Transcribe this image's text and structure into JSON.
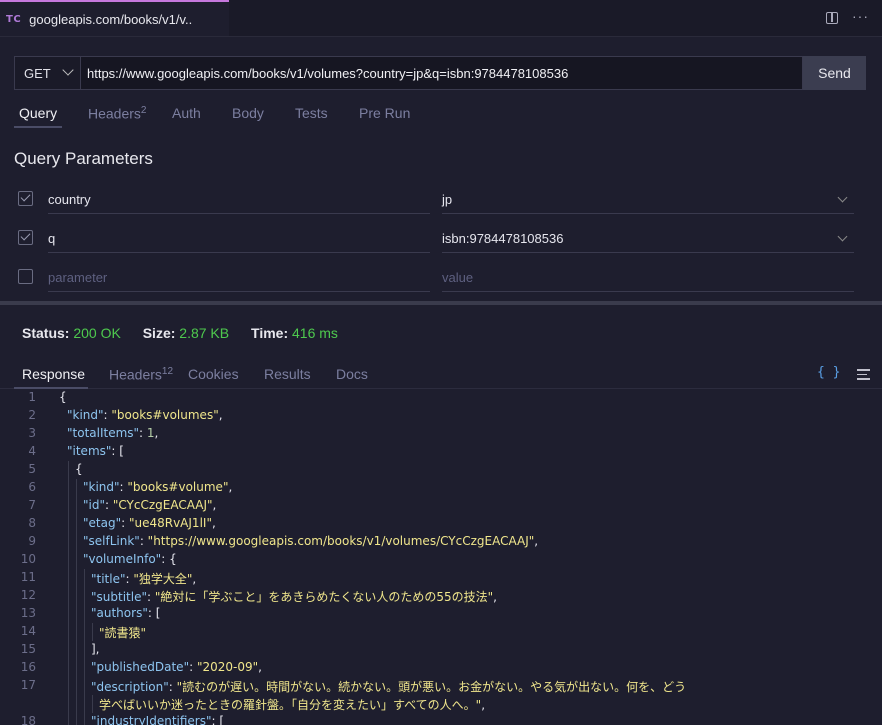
{
  "tab": {
    "logo": "TC",
    "title": "googleapis.com/books/v1/v.."
  },
  "toolbar": {
    "split_icon": "split-view-icon",
    "more_icon": "more-icon"
  },
  "request": {
    "method": "GET",
    "url": "https://www.googleapis.com/books/v1/volumes?country=jp&q=isbn:9784478108536",
    "send_label": "Send"
  },
  "request_tabs": [
    {
      "label": "Query",
      "badge": ""
    },
    {
      "label": "Headers",
      "badge": "2"
    },
    {
      "label": "Auth",
      "badge": ""
    },
    {
      "label": "Body",
      "badge": ""
    },
    {
      "label": "Tests",
      "badge": ""
    },
    {
      "label": "Pre Run",
      "badge": ""
    }
  ],
  "query_params": {
    "title": "Query Parameters",
    "rows": [
      {
        "key": "country",
        "value": "jp",
        "checked": true
      },
      {
        "key": "q",
        "value": "isbn:9784478108536",
        "checked": true
      }
    ],
    "new_row": {
      "key_placeholder": "parameter",
      "value_placeholder": "value"
    }
  },
  "status": {
    "status_label": "Status:",
    "status_value": "200 OK",
    "size_label": "Size:",
    "size_value": "2.87 KB",
    "time_label": "Time:",
    "time_value": "416 ms"
  },
  "response_tabs": [
    {
      "label": "Response",
      "badge": ""
    },
    {
      "label": "Headers",
      "badge": "12"
    },
    {
      "label": "Cookies",
      "badge": ""
    },
    {
      "label": "Results",
      "badge": ""
    },
    {
      "label": "Docs",
      "badge": ""
    }
  ],
  "response_icons": {
    "format": "{ }",
    "menu": "menu-icon"
  },
  "code_lines": [
    {
      "n": "1",
      "indent": 0,
      "parts": [
        [
          "p",
          "{"
        ]
      ]
    },
    {
      "n": "2",
      "indent": 1,
      "parts": [
        [
          "k",
          "\"kind\""
        ],
        [
          "p",
          ": "
        ],
        [
          "s",
          "\"books#volumes\""
        ],
        [
          "p",
          ","
        ]
      ]
    },
    {
      "n": "3",
      "indent": 1,
      "parts": [
        [
          "k",
          "\"totalItems\""
        ],
        [
          "p",
          ": "
        ],
        [
          "n",
          "1"
        ],
        [
          "p",
          ","
        ]
      ]
    },
    {
      "n": "4",
      "indent": 1,
      "parts": [
        [
          "k",
          "\"items\""
        ],
        [
          "p",
          ": ["
        ]
      ]
    },
    {
      "n": "5",
      "indent": 2,
      "parts": [
        [
          "p",
          "{"
        ]
      ]
    },
    {
      "n": "6",
      "indent": 3,
      "parts": [
        [
          "k",
          "\"kind\""
        ],
        [
          "p",
          ": "
        ],
        [
          "s",
          "\"books#volume\""
        ],
        [
          "p",
          ","
        ]
      ]
    },
    {
      "n": "7",
      "indent": 3,
      "parts": [
        [
          "k",
          "\"id\""
        ],
        [
          "p",
          ": "
        ],
        [
          "s",
          "\"CYcCzgEACAAJ\""
        ],
        [
          "p",
          ","
        ]
      ]
    },
    {
      "n": "8",
      "indent": 3,
      "parts": [
        [
          "k",
          "\"etag\""
        ],
        [
          "p",
          ": "
        ],
        [
          "s",
          "\"ue48RvAJ1lI\""
        ],
        [
          "p",
          ","
        ]
      ]
    },
    {
      "n": "9",
      "indent": 3,
      "parts": [
        [
          "k",
          "\"selfLink\""
        ],
        [
          "p",
          ": "
        ],
        [
          "s",
          "\"https://www.googleapis.com/books/v1/volumes/CYcCzgEACAAJ\""
        ],
        [
          "p",
          ","
        ]
      ]
    },
    {
      "n": "10",
      "indent": 3,
      "parts": [
        [
          "k",
          "\"volumeInfo\""
        ],
        [
          "p",
          ": {"
        ]
      ]
    },
    {
      "n": "11",
      "indent": 4,
      "parts": [
        [
          "k",
          "\"title\""
        ],
        [
          "p",
          ": "
        ],
        [
          "s",
          "\"独学大全\""
        ],
        [
          "p",
          ","
        ]
      ]
    },
    {
      "n": "12",
      "indent": 4,
      "parts": [
        [
          "k",
          "\"subtitle\""
        ],
        [
          "p",
          ": "
        ],
        [
          "s",
          "\"絶対に「学ぶこと」をあきらめたくない人のための55の技法\""
        ],
        [
          "p",
          ","
        ]
      ]
    },
    {
      "n": "13",
      "indent": 4,
      "parts": [
        [
          "k",
          "\"authors\""
        ],
        [
          "p",
          ": ["
        ]
      ]
    },
    {
      "n": "14",
      "indent": 5,
      "parts": [
        [
          "s",
          "\"読書猿\""
        ]
      ]
    },
    {
      "n": "15",
      "indent": 4,
      "parts": [
        [
          "p",
          "],"
        ]
      ]
    },
    {
      "n": "16",
      "indent": 4,
      "parts": [
        [
          "k",
          "\"publishedDate\""
        ],
        [
          "p",
          ": "
        ],
        [
          "s",
          "\"2020-09\""
        ],
        [
          "p",
          ","
        ]
      ]
    },
    {
      "n": "17",
      "indent": 4,
      "parts": [
        [
          "k",
          "\"description\""
        ],
        [
          "p",
          ": "
        ],
        [
          "s",
          "\"読むのが遅い。時間がない。続かない。頭が悪い。お金がない。やる気が出ない。何を、どう"
        ]
      ]
    },
    {
      "n": "",
      "indent": 5,
      "parts": [
        [
          "s",
          "学べばいいか迷ったときの羅針盤。「自分を変えたい」すべての人へ。\""
        ],
        [
          "p",
          ","
        ]
      ]
    },
    {
      "n": "18",
      "indent": 4,
      "parts": [
        [
          "k",
          "\"industryIdentifiers\""
        ],
        [
          "p",
          ": ["
        ]
      ]
    }
  ]
}
